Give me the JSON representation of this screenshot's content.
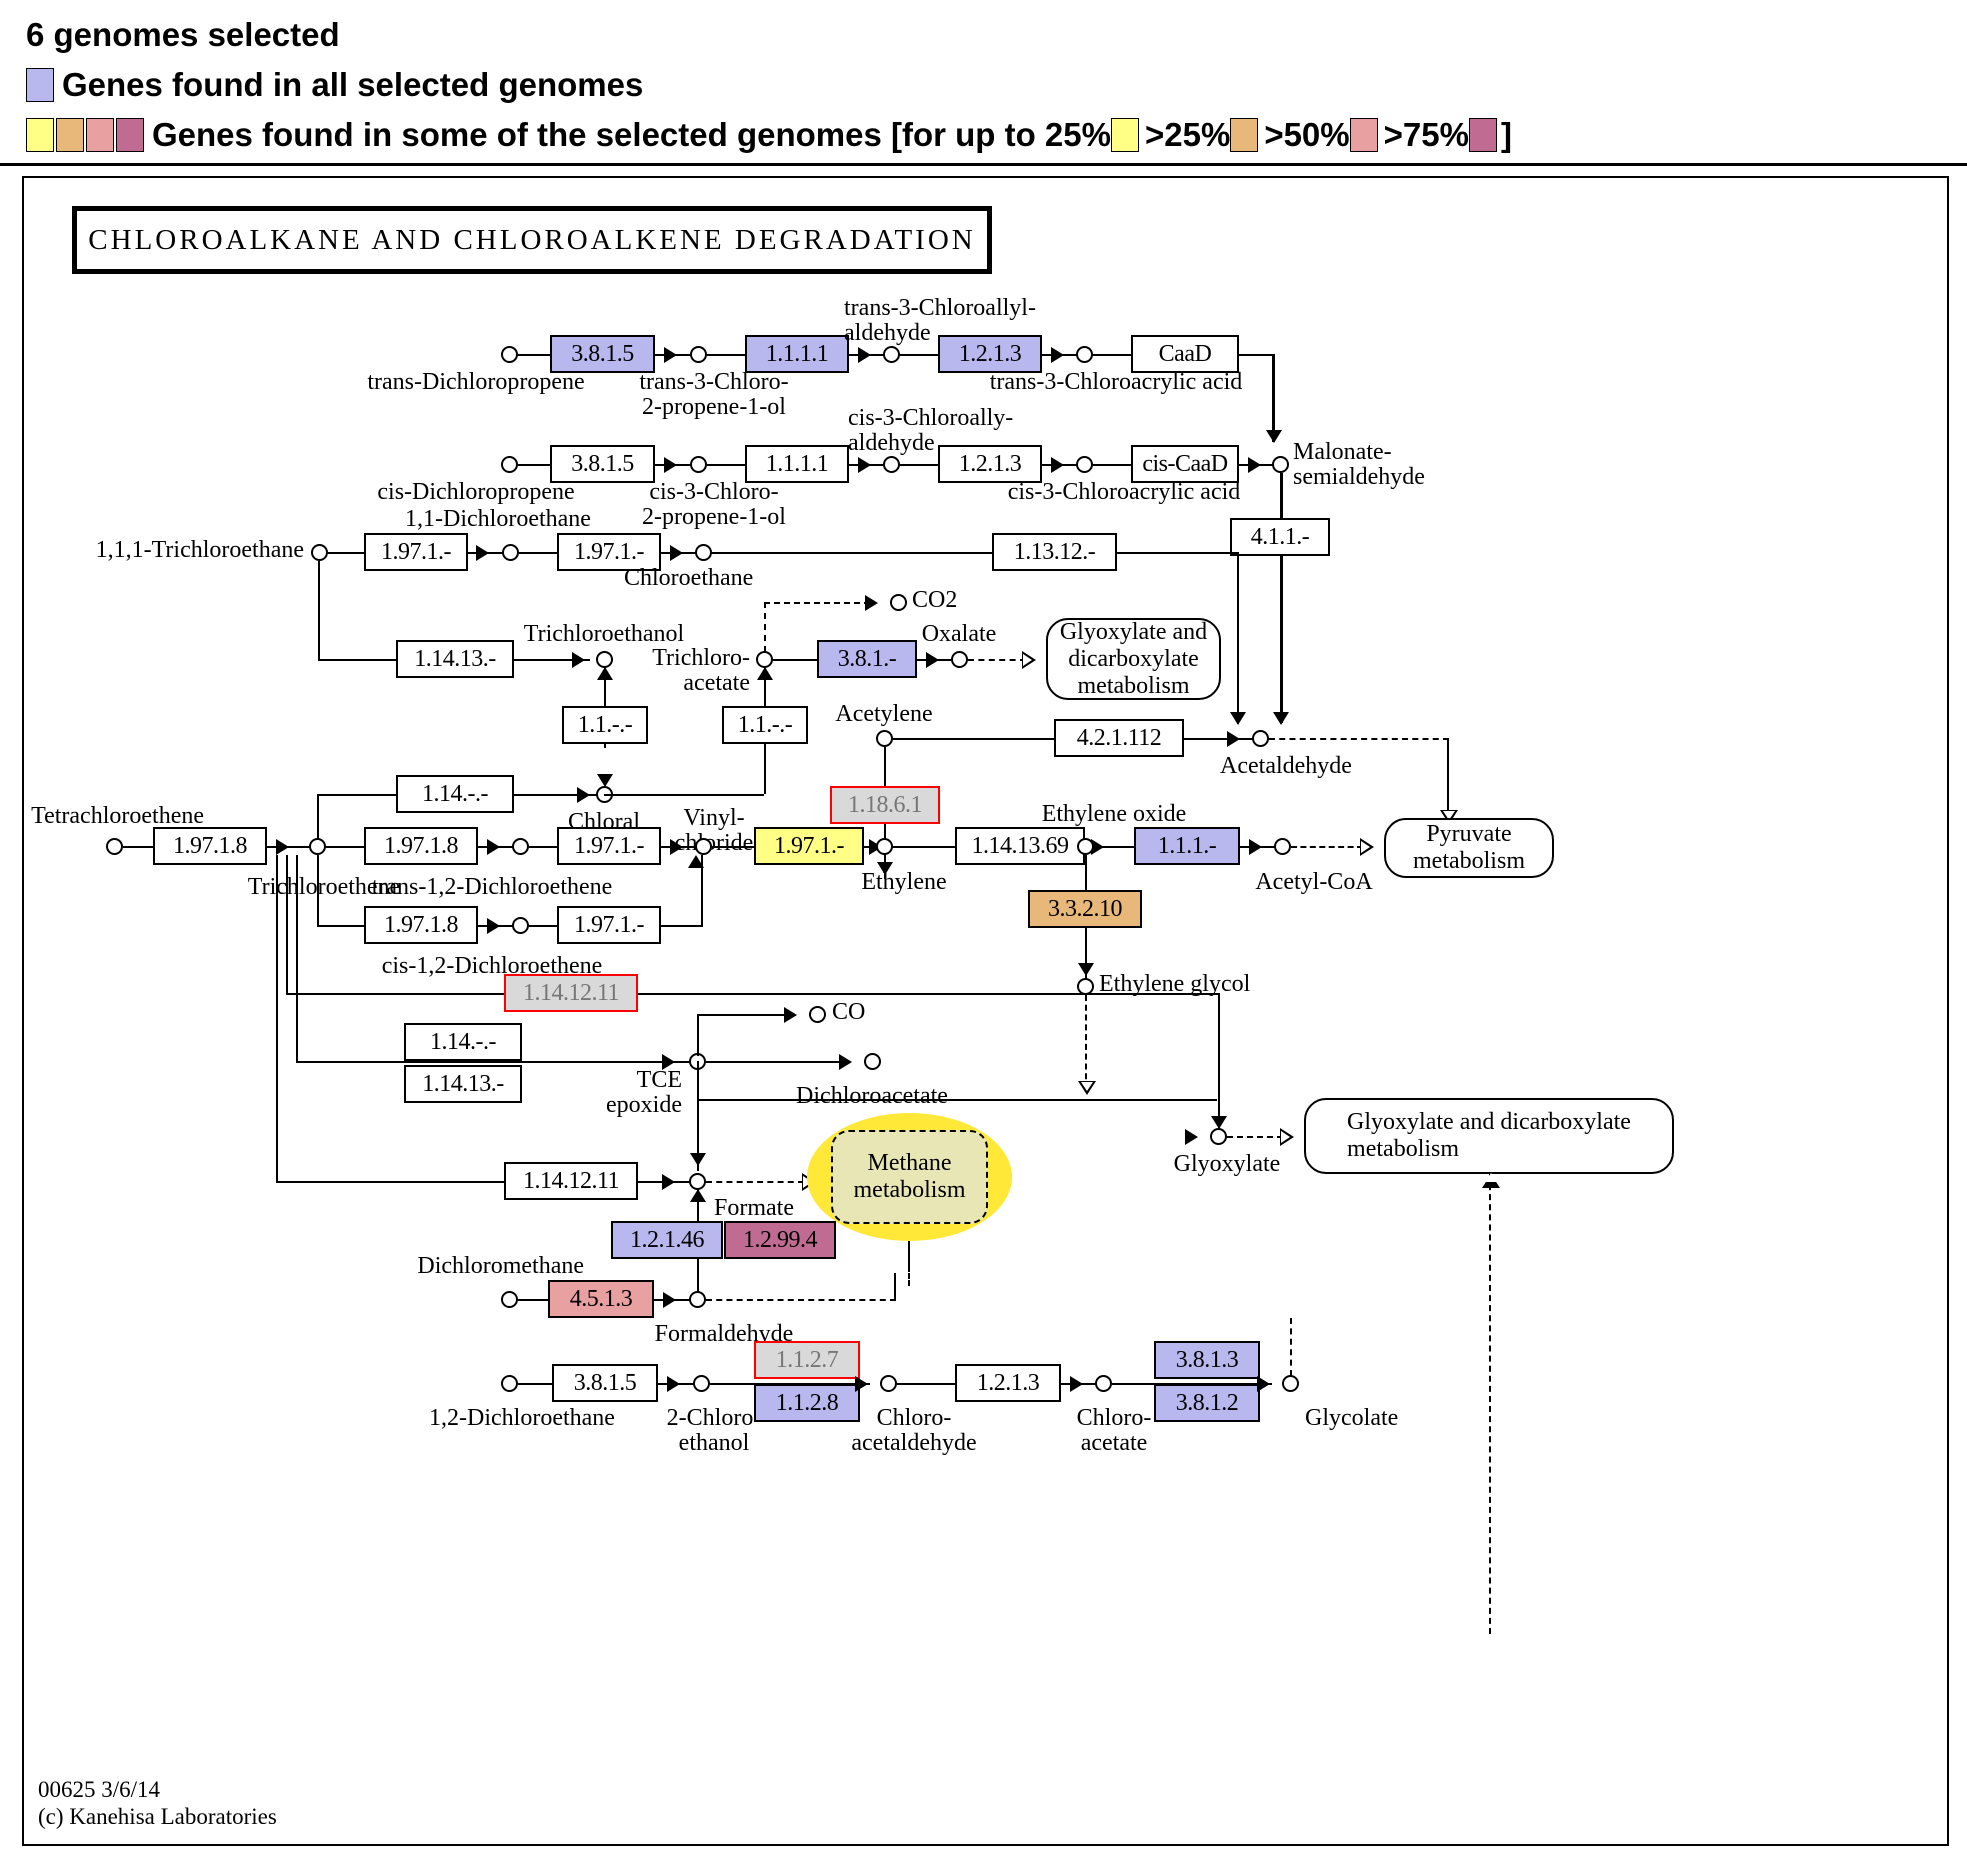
{
  "legend": {
    "genomes_selected": "6 genomes selected",
    "all_genomes_label": "Genes found in all selected genomes",
    "some_genomes_label": "Genes found in some of the selected genomes [for up to 25%",
    "threshold_25": ">25%",
    "threshold_50": ">50%",
    "threshold_75": ">75%",
    "bracket_close": "]",
    "colors": {
      "all": "#b8b8ee",
      "upto25": "#ffff85",
      "gt25": "#e8b87a",
      "gt50": "#e8a0a0",
      "gt75": "#c06c92"
    }
  },
  "map": {
    "title": "CHLOROALKANE  AND  CHLOROALKENE  DEGRADATION",
    "footer": "00625 3/6/14\n(c) Kanehisa Laboratories"
  },
  "compounds": {
    "trans_dichloropropene": "trans-Dichloropropene",
    "trans_3_chloro_2_propene_1_ol": "trans-3-Chloro-\n2-propene-1-ol",
    "trans_3_chloroallyl_aldehyde": "trans-3-Chloroallyl-\naldehyde",
    "trans_3_chloroacrylic_acid": "trans-3-Chloroacrylic acid",
    "cis_dichloropropene": "cis-Dichloropropene",
    "cis_3_chloro_2_propene_1_ol": "cis-3-Chloro-\n2-propene-1-ol",
    "cis_3_chloroally_aldehyde": "cis-3-Chloroally-\naldehyde",
    "cis_3_chloroacrylic_acid": "cis-3-Chloroacrylic acid",
    "malonate_semialdehyde": "Malonate-\nsemialdehyde",
    "trichloroethane_111": "1,1,1-Trichloroethane",
    "dichloroethane_11": "1,1-Dichloroethane",
    "chloroethane": "Chloroethane",
    "co2": "CO2",
    "trichloroethanol": "Trichloroethanol",
    "trichloroacetate": "Trichloro-\nacetate",
    "oxalate": "Oxalate",
    "acetylene": "Acetylene",
    "acetaldehyde": "Acetaldehyde",
    "chloral": "Chloral",
    "vinyl_chloride": "Vinyl-\nchloride",
    "tetrachloroethene": "Tetrachloroethene",
    "trichloroethene": "Trichloroethene",
    "trans_12_dichloroethene": "trans-1,2-Dichloroethene",
    "cis_12_dichloroethene": "cis-1,2-Dichloroethene",
    "ethylene": "Ethylene",
    "ethylene_oxide": "Ethylene oxide",
    "acetyl_coa": "Acetyl-CoA",
    "ethylene_glycol": "Ethylene glycol",
    "co": "CO",
    "tce_epoxide": "TCE\nepoxide",
    "dichloroacetate": "Dichloroacetate",
    "glyoxylate": "Glyoxylate",
    "formate": "Formate",
    "dichloromethane": "Dichloromethane",
    "formaldehyde": "Formaldehyde",
    "dichloroethane_12": "1,2-Dichloroethane",
    "chloroethanol_2": "2-Chloro-\nethanol",
    "chloroacetaldehyde": "Chloro-\nacetaldehyde",
    "chloroacetate": "Chloro-\nacetate",
    "glycolate": "Glycolate"
  },
  "enzymes": {
    "e_3815_a": {
      "label": "3.8.1.5",
      "color": "blue"
    },
    "e_1111_a": {
      "label": "1.1.1.1",
      "color": "blue"
    },
    "e_1213_a": {
      "label": "1.2.1.3",
      "color": "blue"
    },
    "e_caad": {
      "label": "CaaD",
      "color": "white"
    },
    "e_3815_b": {
      "label": "3.8.1.5",
      "color": "white"
    },
    "e_1111_b": {
      "label": "1.1.1.1",
      "color": "white"
    },
    "e_1213_b": {
      "label": "1.2.1.3",
      "color": "white"
    },
    "e_ciscaad": {
      "label": "cis-CaaD",
      "color": "white"
    },
    "e_411": {
      "label": "4.1.1.-",
      "color": "white"
    },
    "e_1971_a": {
      "label": "1.97.1.-",
      "color": "white"
    },
    "e_1971_b": {
      "label": "1.97.1.-",
      "color": "white"
    },
    "e_11312": {
      "label": "1.13.12.-",
      "color": "white"
    },
    "e_11413": {
      "label": "1.14.13.-",
      "color": "white"
    },
    "e_381": {
      "label": "3.8.1.-",
      "color": "blue"
    },
    "e_11_a": {
      "label": "1.1.-.-",
      "color": "white"
    },
    "e_11_b": {
      "label": "1.1.-.-",
      "color": "white"
    },
    "e_114": {
      "label": "1.14.-.-",
      "color": "white"
    },
    "e_421112": {
      "label": "4.2.1.112",
      "color": "white"
    },
    "e_11861": {
      "label": "1.18.6.1",
      "color": "grey"
    },
    "e_19718_a": {
      "label": "1.97.1.8",
      "color": "white"
    },
    "e_19718_b": {
      "label": "1.97.1.8",
      "color": "white"
    },
    "e_19718_c": {
      "label": "1.97.1.8",
      "color": "white"
    },
    "e_1971_c": {
      "label": "1.97.1.-",
      "color": "white"
    },
    "e_1971_d": {
      "label": "1.97.1.-",
      "color": "white"
    },
    "e_1971_yellow": {
      "label": "1.97.1.-",
      "color": "yellow"
    },
    "e_1141369": {
      "label": "1.14.13.69",
      "color": "white"
    },
    "e_111": {
      "label": "1.1.1.-",
      "color": "blue"
    },
    "e_33210": {
      "label": "3.3.2.10",
      "color": "orange"
    },
    "e_1141211_a": {
      "label": "1.14.12.11",
      "color": "grey"
    },
    "e_114b": {
      "label": "1.14.-.-",
      "color": "white"
    },
    "e_11413b": {
      "label": "1.14.13.-",
      "color": "white"
    },
    "e_1141211_b": {
      "label": "1.14.12.11",
      "color": "white"
    },
    "e_12146": {
      "label": "1.2.1.46",
      "color": "blue"
    },
    "e_12994": {
      "label": "1.2.99.4",
      "color": "magenta"
    },
    "e_4513": {
      "label": "4.5.1.3",
      "color": "pink"
    },
    "e_3815_c": {
      "label": "3.8.1.5",
      "color": "white"
    },
    "e_1127": {
      "label": "1.1.2.7",
      "color": "grey"
    },
    "e_1128": {
      "label": "1.1.2.8",
      "color": "blue"
    },
    "e_1213_c": {
      "label": "1.2.1.3",
      "color": "white"
    },
    "e_3813": {
      "label": "3.8.1.3",
      "color": "blue"
    },
    "e_3812": {
      "label": "3.8.1.2",
      "color": "blue"
    }
  },
  "maprefs": {
    "glyoxylate_dicarb_1": "Glyoxylate and\ndicarboxylate\nmetabolism",
    "glyoxylate_dicarb_2": "Glyoxylate and dicarboxylate\nmetabolism",
    "pyruvate": "Pyruvate\nmetabolism",
    "methane": "Methane\nmetabolism"
  }
}
